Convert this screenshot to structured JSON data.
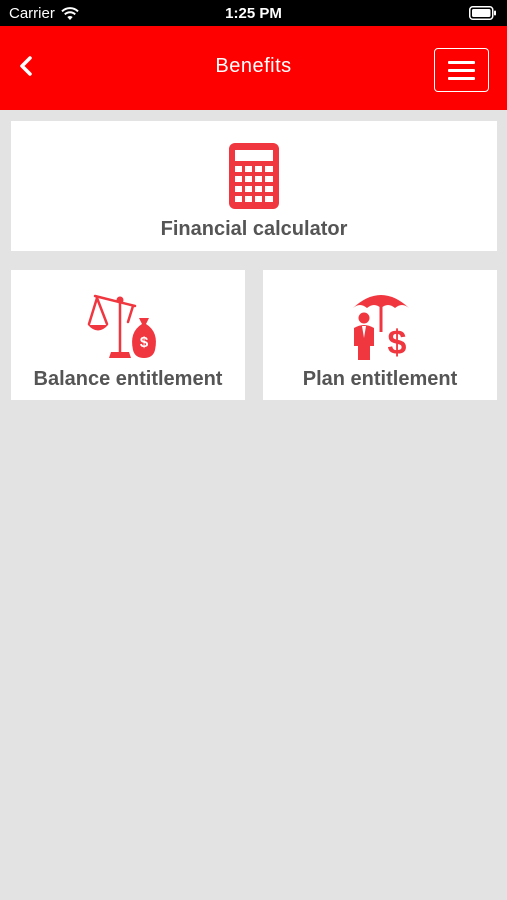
{
  "status_bar": {
    "carrier": "Carrier",
    "time": "1:25 PM"
  },
  "nav": {
    "title": "Benefits",
    "back_icon": "chevron-left-icon",
    "menu_icon": "hamburger-menu-icon"
  },
  "cards": {
    "financial_calculator": {
      "label": "Financial calculator",
      "icon": "calculator-icon"
    },
    "balance_entitlement": {
      "label": "Balance entitlement",
      "icon": "scale-money-bag-icon"
    },
    "plan_entitlement": {
      "label": "Plan entitlement",
      "icon": "umbrella-person-dollar-icon"
    }
  },
  "colors": {
    "brand_red": "#ff0000",
    "icon_red": "#f0363f",
    "background": "#e3e3e3",
    "label_gray": "#555555"
  }
}
